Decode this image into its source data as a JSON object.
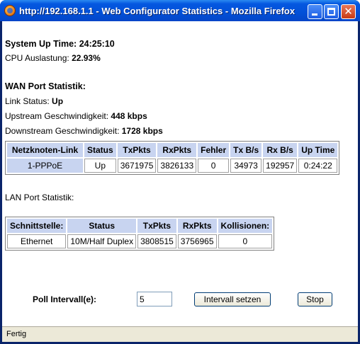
{
  "window": {
    "title": "http://192.168.1.1 - Web Configurator Statistics - Mozilla Firefox",
    "status": "Fertig"
  },
  "system": {
    "uptime_label": "System Up Time:",
    "uptime_value": "24:25:10",
    "cpu_label": "CPU Auslastung:",
    "cpu_value": "22.93%"
  },
  "wan": {
    "heading": "WAN Port Statistik:",
    "link_label": "Link Status:",
    "link_value": "Up",
    "up_label": "Upstream Geschwindigkeit:",
    "up_value": "448 kbps",
    "down_label": "Downstream Geschwindigkeit:",
    "down_value": "1728 kbps",
    "columns": [
      "Netzknoten-Link",
      "Status",
      "TxPkts",
      "RxPkts",
      "Fehler",
      "Tx B/s",
      "Rx B/s",
      "Up Time"
    ],
    "row": [
      "1-PPPoE",
      "Up",
      "3671975",
      "3826133",
      "0",
      "34973",
      "192957",
      "0:24:22"
    ]
  },
  "lan": {
    "heading": "LAN Port Statistik:",
    "columns": [
      "Schnittstelle:",
      "Status",
      "TxPkts",
      "RxPkts",
      "Kollisionen:"
    ],
    "row": [
      "Ethernet",
      "10M/Half Duplex",
      "3808515",
      "3756965",
      "0"
    ]
  },
  "poll": {
    "label": "Poll Intervall(e):",
    "value": "5",
    "set_button": "Intervall setzen",
    "stop_button": "Stop"
  },
  "colors": {
    "table_header": "#c8d4f0",
    "titlebar": "#0558e0"
  }
}
